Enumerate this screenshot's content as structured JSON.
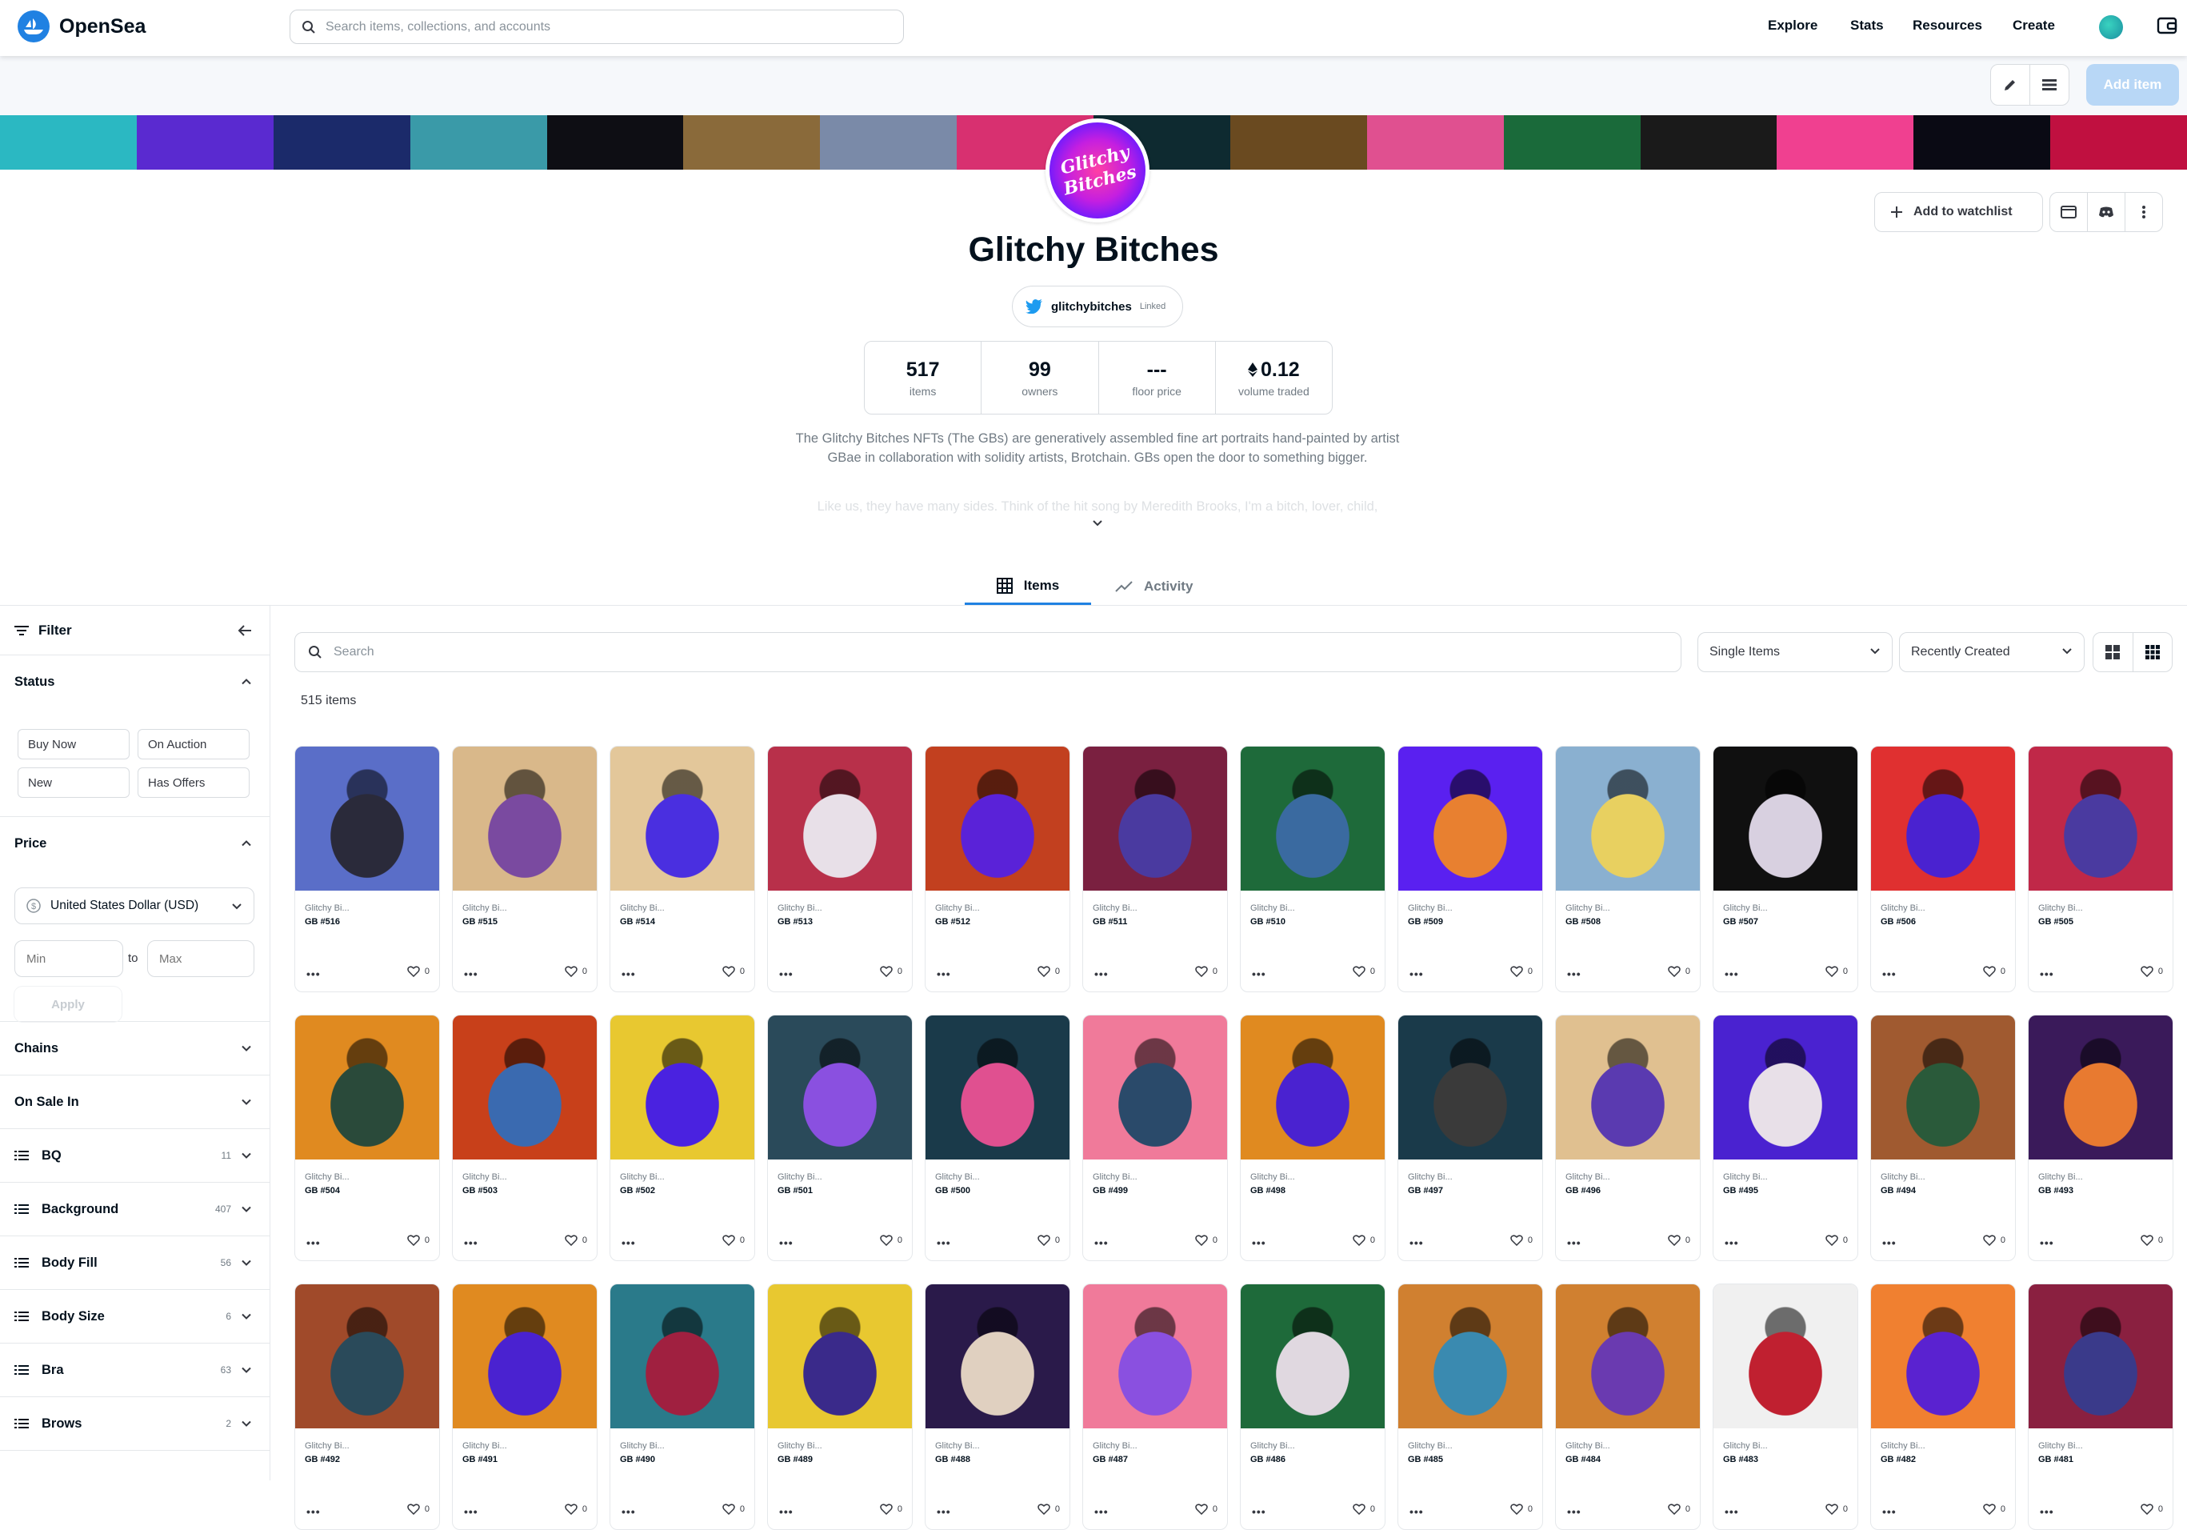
{
  "nav": {
    "logo_text": "OpenSea",
    "search_placeholder": "Search items, collections, and accounts",
    "links": [
      "Explore",
      "Stats",
      "Resources",
      "Create"
    ]
  },
  "toolbar": {
    "add_item_label": "Add item"
  },
  "collection": {
    "avatar_text": "Glitchy Bitches",
    "title": "Glitchy Bitches",
    "watchlist_label": "Add to watchlist",
    "twitter_handle": "glitchybitches",
    "twitter_linked": "Linked",
    "stats": [
      {
        "value": "517",
        "label": "items"
      },
      {
        "value": "99",
        "label": "owners"
      },
      {
        "value": "---",
        "label": "floor price"
      },
      {
        "value": "0.12",
        "label": "volume traded"
      }
    ],
    "description": "The Glitchy Bitches NFTs (The GBs) are generatively assembled fine art portraits hand-painted by artist GBae in collaboration with solidity artists, Brotchain. GBs open the door to something bigger.",
    "description_more": "Like us, they have many sides. Think of the hit song by Meredith Brooks, I'm a bitch, lover, child,"
  },
  "tabs": [
    {
      "label": "Items"
    },
    {
      "label": "Activity"
    }
  ],
  "sidebar": {
    "filter_label": "Filter",
    "status": {
      "label": "Status",
      "options": [
        "Buy Now",
        "On Auction",
        "New",
        "Has Offers"
      ]
    },
    "price": {
      "label": "Price",
      "currency": "United States Dollar (USD)",
      "min_placeholder": "Min",
      "to": "to",
      "max_placeholder": "Max",
      "apply": "Apply"
    },
    "chains": "Chains",
    "on_sale_in": "On Sale In",
    "traits": [
      {
        "label": "BQ",
        "count": "11"
      },
      {
        "label": "Background",
        "count": "407"
      },
      {
        "label": "Body Fill",
        "count": "56"
      },
      {
        "label": "Body Size",
        "count": "6"
      },
      {
        "label": "Bra",
        "count": "63"
      },
      {
        "label": "Brows",
        "count": "2"
      }
    ]
  },
  "main": {
    "search_placeholder": "Search",
    "type_select": "Single Items",
    "sort_select": "Recently Created",
    "item_count": "515 items"
  },
  "items": [
    {
      "name": "Glitchy Bi...",
      "id": "GB #516",
      "likes": "0",
      "c1": "#5a6ec8",
      "c2": "#2a2a3a"
    },
    {
      "name": "Glitchy Bi...",
      "id": "GB #515",
      "likes": "0",
      "c1": "#d9b88a",
      "c2": "#7a4aa0"
    },
    {
      "name": "Glitchy Bi...",
      "id": "GB #514",
      "likes": "0",
      "c1": "#e3c79a",
      "c2": "#4a2fe0"
    },
    {
      "name": "Glitchy Bi...",
      "id": "GB #513",
      "likes": "0",
      "c1": "#b8304a",
      "c2": "#e8e0e8"
    },
    {
      "name": "Glitchy Bi...",
      "id": "GB #512",
      "likes": "0",
      "c1": "#c2401f",
      "c2": "#5a22d8"
    },
    {
      "name": "Glitchy Bi...",
      "id": "GB #511",
      "likes": "0",
      "c1": "#7a2040",
      "c2": "#4a3aa0"
    },
    {
      "name": "Glitchy Bi...",
      "id": "GB #510",
      "likes": "0",
      "c1": "#1e6a3a",
      "c2": "#3a6aa0"
    },
    {
      "name": "Glitchy Bi...",
      "id": "GB #509",
      "likes": "0",
      "c1": "#5a20f0",
      "c2": "#e88030"
    },
    {
      "name": "Glitchy Bi...",
      "id": "GB #508",
      "likes": "0",
      "c1": "#8ab0d0",
      "c2": "#e8d060"
    },
    {
      "name": "Glitchy Bi...",
      "id": "GB #507",
      "likes": "0",
      "c1": "#101010",
      "c2": "#d8d0e0"
    },
    {
      "name": "Glitchy Bi...",
      "id": "GB #506",
      "likes": "0",
      "c1": "#e03030",
      "c2": "#4a22d0"
    },
    {
      "name": "Glitchy Bi...",
      "id": "GB #505",
      "likes": "0",
      "c1": "#c02848",
      "c2": "#4a3aa0"
    },
    {
      "name": "Glitchy Bi...",
      "id": "GB #504",
      "likes": "0",
      "c1": "#e08a20",
      "c2": "#2a4a3a"
    },
    {
      "name": "Glitchy Bi...",
      "id": "GB #503",
      "likes": "0",
      "c1": "#c8401a",
      "c2": "#3a6ab0"
    },
    {
      "name": "Glitchy Bi...",
      "id": "GB #502",
      "likes": "0",
      "c1": "#e8c830",
      "c2": "#4a22e0"
    },
    {
      "name": "Glitchy Bi...",
      "id": "GB #501",
      "likes": "0",
      "c1": "#2a4a5a",
      "c2": "#8a50e0"
    },
    {
      "name": "Glitchy Bi...",
      "id": "GB #500",
      "likes": "0",
      "c1": "#1a3a4a",
      "c2": "#e05090"
    },
    {
      "name": "Glitchy Bi...",
      "id": "GB #499",
      "likes": "0",
      "c1": "#f07a9a",
      "c2": "#2a4a6a"
    },
    {
      "name": "Glitchy Bi...",
      "id": "GB #498",
      "likes": "0",
      "c1": "#e08a20",
      "c2": "#4a22d0"
    },
    {
      "name": "Glitchy Bi...",
      "id": "GB #497",
      "likes": "0",
      "c1": "#1a3a4a",
      "c2": "#3a3a3a"
    },
    {
      "name": "Glitchy Bi...",
      "id": "GB #496",
      "likes": "0",
      "c1": "#e0c090",
      "c2": "#5a3ab0"
    },
    {
      "name": "Glitchy Bi...",
      "id": "GB #495",
      "likes": "0",
      "c1": "#4a22d0",
      "c2": "#e8e0e8"
    },
    {
      "name": "Glitchy Bi...",
      "id": "GB #494",
      "likes": "0",
      "c1": "#a05a30",
      "c2": "#2a5a3a"
    },
    {
      "name": "Glitchy Bi...",
      "id": "GB #493",
      "likes": "0",
      "c1": "#3a1a5a",
      "c2": "#e87a30"
    },
    {
      "name": "Glitchy Bi...",
      "id": "GB #492",
      "likes": "0",
      "c1": "#a04a2a",
      "c2": "#2a4a5a"
    },
    {
      "name": "Glitchy Bi...",
      "id": "GB #491",
      "likes": "0",
      "c1": "#e08a20",
      "c2": "#4a22d0"
    },
    {
      "name": "Glitchy Bi...",
      "id": "GB #490",
      "likes": "0",
      "c1": "#2a7a8a",
      "c2": "#a02040"
    },
    {
      "name": "Glitchy Bi...",
      "id": "GB #489",
      "likes": "0",
      "c1": "#e8c830",
      "c2": "#3a2a8a"
    },
    {
      "name": "Glitchy Bi...",
      "id": "GB #488",
      "likes": "0",
      "c1": "#2a1a4a",
      "c2": "#e0d0c0"
    },
    {
      "name": "Glitchy Bi...",
      "id": "GB #487",
      "likes": "0",
      "c1": "#f07a9a",
      "c2": "#8a50e0"
    },
    {
      "name": "Glitchy Bi...",
      "id": "GB #486",
      "likes": "0",
      "c1": "#1e6a3a",
      "c2": "#e0d8e0"
    },
    {
      "name": "Glitchy Bi...",
      "id": "GB #485",
      "likes": "0",
      "c1": "#d08030",
      "c2": "#3a8ab0"
    },
    {
      "name": "Glitchy Bi...",
      "id": "GB #484",
      "likes": "0",
      "c1": "#d08030",
      "c2": "#6a3ab0"
    },
    {
      "name": "Glitchy Bi...",
      "id": "GB #483",
      "likes": "0",
      "c1": "#f0f0f0",
      "c2": "#c02030"
    },
    {
      "name": "Glitchy Bi...",
      "id": "GB #482",
      "likes": "0",
      "c1": "#f08030",
      "c2": "#5a22d0"
    },
    {
      "name": "Glitchy Bi...",
      "id": "GB #481",
      "likes": "0",
      "c1": "#8a2040",
      "c2": "#3a3a8a"
    }
  ],
  "banner_colors": [
    "#2bb8c2",
    "#5a2ad0",
    "#1b2a6a",
    "#3a9aa8",
    "#0e0e14",
    "#8a6a3a",
    "#7a8aa8",
    "#d83070",
    "#0e2a30",
    "#6a4a20",
    "#e05090",
    "#1a6a3a",
    "#1a1a1a",
    "#f04090",
    "#0a0a14",
    "#c01040"
  ]
}
